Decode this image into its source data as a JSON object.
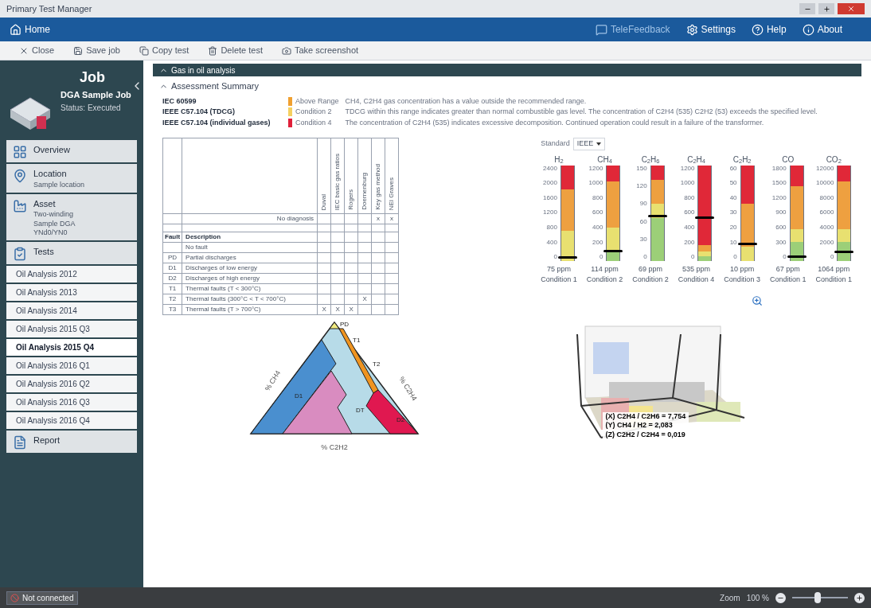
{
  "window": {
    "title": "Primary Test Manager"
  },
  "header": {
    "home": "Home",
    "links": [
      "TeleFeedback",
      "Settings",
      "Help",
      "About"
    ]
  },
  "toolbar": [
    "Close",
    "Save job",
    "Copy test",
    "Delete test",
    "Take screenshot"
  ],
  "sidebar": {
    "title": "Job",
    "job_name": "DGA Sample Job",
    "status": "Status: Executed",
    "nav": [
      {
        "kind": "section",
        "label": "Overview"
      },
      {
        "kind": "section",
        "label": "Location",
        "details": [
          "Sample location"
        ]
      },
      {
        "kind": "section",
        "label": "Asset",
        "details": [
          "Two-winding",
          "Sample DGA",
          "YNd0/YN0"
        ]
      },
      {
        "kind": "section",
        "label": "Tests"
      },
      {
        "kind": "test",
        "label": "Oil Analysis 2012",
        "selected": false
      },
      {
        "kind": "test",
        "label": "Oil Analysis 2013",
        "selected": false
      },
      {
        "kind": "test",
        "label": "Oil Analysis 2014",
        "selected": false
      },
      {
        "kind": "test",
        "label": "Oil Analysis 2015 Q3",
        "selected": false
      },
      {
        "kind": "test",
        "label": "Oil Analysis 2015 Q4",
        "selected": true
      },
      {
        "kind": "test",
        "label": "Oil Analysis 2016 Q1",
        "selected": false
      },
      {
        "kind": "test",
        "label": "Oil Analysis 2016 Q2",
        "selected": false
      },
      {
        "kind": "test",
        "label": "Oil Analysis 2016 Q3",
        "selected": false
      },
      {
        "kind": "test",
        "label": "Oil Analysis 2016 Q4",
        "selected": false
      },
      {
        "kind": "section",
        "label": "Report"
      }
    ]
  },
  "main": {
    "section_title": "Gas in oil analysis",
    "subsection_title": "Assessment Summary",
    "assessments": [
      {
        "standard": "IEC 60599",
        "color": "#f0a030",
        "condition": "Above Range",
        "message": "CH4, C2H4 gas concentration has a value outside the recommended range."
      },
      {
        "standard": "IEEE C57.104 (TDCG)",
        "color": "#f5d060",
        "condition": "Condition 2",
        "message": "TDCG within this range indicates greater than normal combustible gas level. The concentration of C2H4 (535) C2H2 (53) exceeds the specified level."
      },
      {
        "standard": "IEEE C57.104 (individual gases)",
        "color": "#e0203a",
        "condition": "Condition 4",
        "message": "The concentration of C2H4 (535) indicates excessive decomposition. Continued operation could result in a failure of the transformer."
      }
    ],
    "diagnosis_table": {
      "columns": [
        "Duval",
        "IEC basic gas ratios",
        "Rogers",
        "Doernenburg",
        "Key gas method",
        "NEI Graves"
      ],
      "no_diagnosis": {
        "label": "No diagnosis",
        "cells": [
          null,
          null,
          null,
          null,
          "x",
          "x"
        ]
      },
      "fault_header": "Fault",
      "description_header": "Description",
      "rows": [
        {
          "code": null,
          "description": "No fault",
          "cells": [
            null,
            null,
            null,
            null,
            null,
            null
          ]
        },
        {
          "code": "PD",
          "description": "Partial discharges",
          "cells": [
            null,
            null,
            null,
            null,
            null,
            null
          ]
        },
        {
          "code": "D1",
          "description": "Discharges of low energy",
          "cells": [
            null,
            null,
            null,
            null,
            null,
            null
          ]
        },
        {
          "code": "D2",
          "description": "Discharges of high energy",
          "cells": [
            null,
            null,
            null,
            null,
            null,
            null
          ]
        },
        {
          "code": "T1",
          "description": "Thermal faults (T < 300°C)",
          "cells": [
            null,
            null,
            null,
            null,
            null,
            null
          ]
        },
        {
          "code": "T2",
          "description": "Thermal faults (300°C < T < 700°C)",
          "cells": [
            null,
            null,
            null,
            "X",
            null,
            null
          ]
        },
        {
          "code": "T3",
          "description": "Thermal faults (T > 700°C)",
          "cells": [
            "X",
            "X",
            "X",
            null,
            null,
            null
          ]
        }
      ]
    },
    "standard_select": {
      "label": "Standard",
      "value": "IEEE"
    },
    "gauges": [
      {
        "gas": "H$_{2}$",
        "ticks": [
          "2400",
          "2000",
          "1600",
          "1200",
          "800",
          "400",
          "0"
        ],
        "level": 0.03,
        "reading": "75 ppm",
        "condition": "Condition 1"
      },
      {
        "gas": "CH$_{4}$",
        "ticks": [
          "1200",
          "1000",
          "800",
          "600",
          "400",
          "200",
          "0"
        ],
        "level": 0.1,
        "reading": "114 ppm",
        "condition": "Condition 2"
      },
      {
        "gas": "C$_{2}$H$_{6}$",
        "ticks": [
          "150",
          "120",
          "90",
          "60",
          "30",
          "0"
        ],
        "level": 0.46,
        "reading": "69 ppm",
        "condition": "Condition 2"
      },
      {
        "gas": "C$_{2}$H$_{4}$",
        "ticks": [
          "1200",
          "1000",
          "800",
          "600",
          "400",
          "200",
          "0"
        ],
        "level": 0.45,
        "reading": "535 ppm",
        "condition": "Condition 4"
      },
      {
        "gas": "C$_{2}$H$_{2}$",
        "ticks": [
          "60",
          "50",
          "40",
          "30",
          "20",
          "10",
          "0"
        ],
        "level": 0.17,
        "reading": "10 ppm",
        "condition": "Condition 3"
      },
      {
        "gas": "CO",
        "ticks": [
          "1800",
          "1500",
          "1200",
          "900",
          "600",
          "300",
          "0"
        ],
        "level": 0.04,
        "reading": "67 ppm",
        "condition": "Condition 1"
      },
      {
        "gas": "CO$_{2}$",
        "ticks": [
          "12000",
          "10000",
          "8000",
          "6000",
          "4000",
          "2000",
          "0"
        ],
        "level": 0.09,
        "reading": "1064 ppm",
        "condition": "Condition 1"
      }
    ],
    "duval": {
      "zones": [
        "PD",
        "T1",
        "T2",
        "D1",
        "D2",
        "DT"
      ],
      "axes": [
        "% CH4",
        "% C2H4",
        "% C2H2"
      ]
    },
    "ratios": [
      "(X) C2H4 / C2H6 = 7,754",
      "(Y) CH4 / H2 = 2,083",
      "(Z) C2H2 / C2H4 = 0,019"
    ]
  },
  "status_bar": {
    "connection": "Not connected",
    "zoom_label": "Zoom",
    "zoom_value": "100 %",
    "zoom": {
      "level": 0.45
    }
  }
}
